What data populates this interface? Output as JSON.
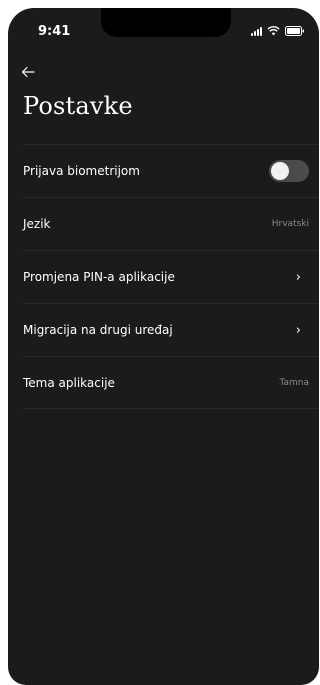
{
  "status_bar": {
    "time": "9:41"
  },
  "header": {
    "title": "Postavke"
  },
  "settings": {
    "biometric_label": "Prijava biometrijom",
    "biometric_enabled": false,
    "language_label": "Jezik",
    "language_value": "Hrvatski",
    "pin_label": "Promjena PIN-a aplikacije",
    "migration_label": "Migracija na drugi uređaj",
    "theme_label": "Tema aplikacije",
    "theme_value": "Tamna"
  },
  "icons": {
    "back": "arrow-left-icon",
    "chevron": "chevron-right-icon",
    "signal": "cellular-signal-icon",
    "wifi": "wifi-icon",
    "battery": "battery-icon"
  },
  "colors": {
    "background": "#1b1b1b",
    "text": "#ffffff",
    "muted": "#8a8a8a",
    "toggle_off": "#4b4b4b"
  }
}
